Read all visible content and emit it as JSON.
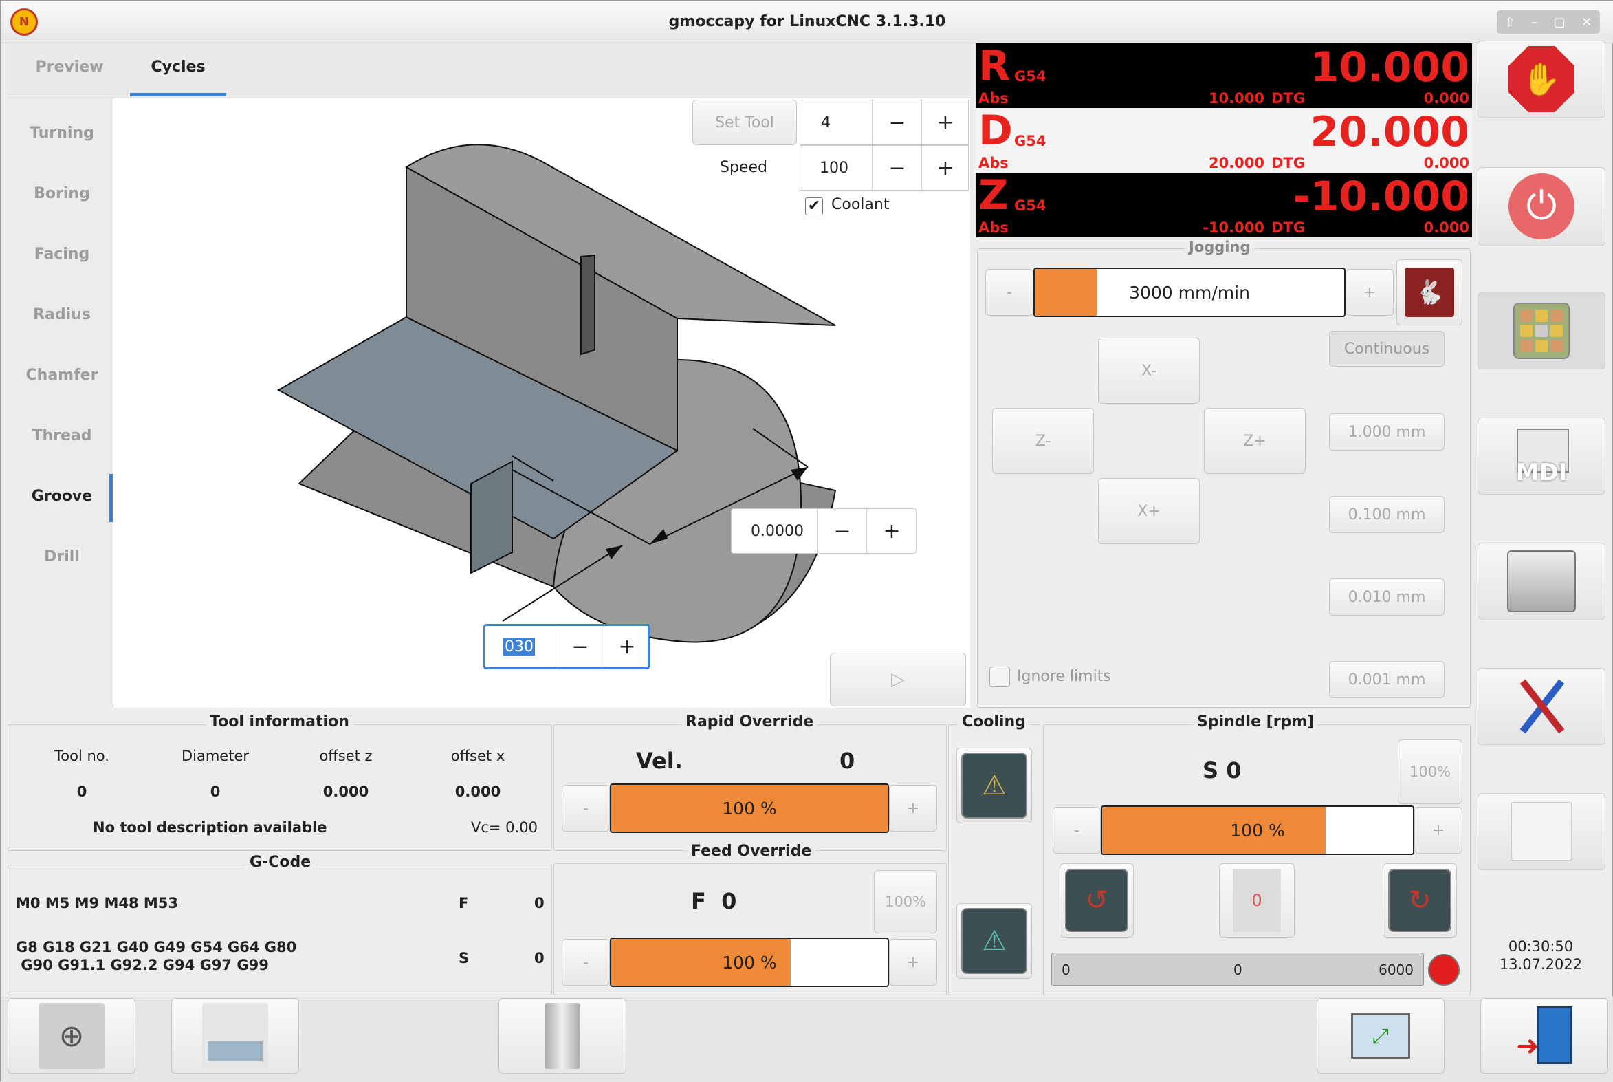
{
  "window": {
    "title": "gmoccapy for LinuxCNC  3.1.3.10",
    "logo_text": "N"
  },
  "tabs": [
    {
      "label": "Preview"
    },
    {
      "label": "Cycles"
    }
  ],
  "sidebar": {
    "items": [
      {
        "label": "Turning"
      },
      {
        "label": "Boring"
      },
      {
        "label": "Facing"
      },
      {
        "label": "Radius"
      },
      {
        "label": "Chamfer"
      },
      {
        "label": "Thread"
      },
      {
        "label": "Groove"
      },
      {
        "label": "Drill"
      }
    ],
    "active": "Groove"
  },
  "cycle": {
    "set_tool_label": "Set Tool",
    "tool_value": "4",
    "speed_label": "Speed",
    "speed_value": "100",
    "coolant_label": "Coolant",
    "coolant_checked": true,
    "dim1_value": "0.0000",
    "dim2_value": "030",
    "minus": "−",
    "plus": "+",
    "run_symbol": "▷"
  },
  "dro": {
    "r": {
      "letter": "R",
      "g": "G54",
      "value": "10.000",
      "abs_label": "Abs",
      "abs": "10.000",
      "dtg_label": "DTG",
      "dtg": "0.000"
    },
    "d": {
      "letter": "D",
      "g": "G54",
      "value": "20.000",
      "abs_label": "Abs",
      "abs": "20.000",
      "dtg_label": "DTG",
      "dtg": "0.000"
    },
    "z": {
      "letter": "Z",
      "g": "G54",
      "value": "-10.000",
      "abs_label": "Abs",
      "abs": "-10.000",
      "dtg_label": "DTG",
      "dtg": "0.000"
    }
  },
  "jogging": {
    "title": "Jogging",
    "minus": "-",
    "plus": "+",
    "speed_text": "3000 mm/min",
    "speed_fraction": 0.2,
    "continuous": "Continuous",
    "x_minus": "X-",
    "x_plus": "X+",
    "z_minus": "Z-",
    "z_plus": "Z+",
    "increments": [
      "1.000 mm",
      "0.100 mm",
      "0.010 mm",
      "0.001 mm"
    ],
    "ignore_limits": "Ignore limits"
  },
  "tool_info": {
    "title": "Tool information",
    "headers": [
      "Tool no.",
      "Diameter",
      "offset z",
      "offset x"
    ],
    "values": [
      "0",
      "0",
      "0.000",
      "0.000"
    ],
    "description": "No tool description available",
    "vc": "Vc= 0.00"
  },
  "gcode": {
    "title": "G-Code",
    "mcodes": "M0 M5 M9 M48 M53",
    "gcodes_line1": "G8 G18 G21 G40 G49 G54 G64 G80",
    "gcodes_line2": " G90 G91.1 G92.2 G94 G97 G99",
    "f_label": "F",
    "f_value": "0",
    "s_label": "S",
    "s_value": "0"
  },
  "rapid": {
    "title": "Rapid Override",
    "vel_label": "Vel.",
    "vel_value": "0",
    "bar_text": "100 %",
    "fraction": 1.0,
    "minus": "-",
    "plus": "+"
  },
  "feed": {
    "title": "Feed Override",
    "f_label": "F  0",
    "reset": "100%",
    "bar_text": "100 %",
    "fraction": 0.65,
    "minus": "-",
    "plus": "+"
  },
  "cooling": {
    "title": "Cooling"
  },
  "spindle": {
    "title": "Spindle [rpm]",
    "s_label": "S 0",
    "reset": "100%",
    "bar_text": "100 %",
    "fraction": 0.72,
    "minus": "-",
    "plus": "+",
    "gauge_min": "0",
    "gauge_value": "0",
    "gauge_max": "6000",
    "stop_digit": "0"
  },
  "clock": {
    "time": "00:30:50",
    "date": "13.07.2022"
  },
  "right_buttons": {
    "mdi_label": "MDI"
  },
  "colors": {
    "orange": "#ef8a3a",
    "dro_red": "#e8221f",
    "estop_red": "#d9252b",
    "active_tab": "#3b83d6"
  }
}
